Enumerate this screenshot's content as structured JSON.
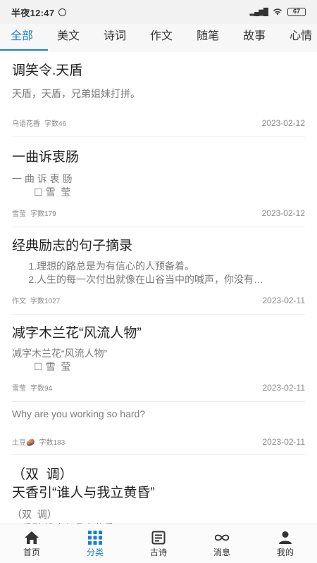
{
  "status_bar": {
    "time": "半夜12:47",
    "network": "4G",
    "battery": "67"
  },
  "tabs": [
    {
      "label": "全部",
      "active": true
    },
    {
      "label": "美文",
      "active": false
    },
    {
      "label": "诗词",
      "active": false
    },
    {
      "label": "作文",
      "active": false
    },
    {
      "label": "随笔",
      "active": false
    },
    {
      "label": "故事",
      "active": false
    },
    {
      "label": "心情",
      "active": false
    }
  ],
  "articles": [
    {
      "title": "调笑令.天盾",
      "excerpt": "天盾，天盾，兄弟姐妹打拼。",
      "author": "鸟语花香",
      "word_count": "字数46",
      "date": "2023-02-12"
    },
    {
      "title": "一曲诉衷肠",
      "excerpt": "一 曲 诉 衷 肠\n        ☐ 雪  莹",
      "author": "雪莹",
      "word_count": "字数179",
      "date": "2023-02-12"
    },
    {
      "title": "经典励志的句子摘录",
      "excerpt": "      1.理想的路总是为有信心的人预备着。\n      2.人生的每一次付出就像在山谷当中的喊声，你没有…",
      "author": "作文",
      "word_count": "字数1027",
      "date": "2023-02-11"
    },
    {
      "title": "减字木兰花“风流人物”",
      "excerpt": "减字木兰花“风流人物”\n        ☐ 雪  莹",
      "author": "雪莹",
      "word_count": "字数94",
      "date": "2023-02-11"
    },
    {
      "title": "",
      "excerpt": "Why are you working so hard?",
      "author": "土豆🥔",
      "word_count": "字数183",
      "date": "2023-02-11"
    },
    {
      "title": "（双  调）\n天香引“谁人与我立黄昏”",
      "excerpt": "（双  调）\n天香引“谁人与我立黄昏”",
      "author": "",
      "word_count": "",
      "date": ""
    }
  ],
  "bottom_nav": [
    {
      "label": "首页",
      "icon": "home-icon",
      "active": false
    },
    {
      "label": "分类",
      "icon": "grid-icon",
      "active": true
    },
    {
      "label": "古诗",
      "icon": "document-icon",
      "active": false
    },
    {
      "label": "消息",
      "icon": "infinity-icon",
      "active": false
    },
    {
      "label": "我的",
      "icon": "user-icon",
      "active": false
    }
  ],
  "colors": {
    "accent": "#1a7fd4"
  }
}
